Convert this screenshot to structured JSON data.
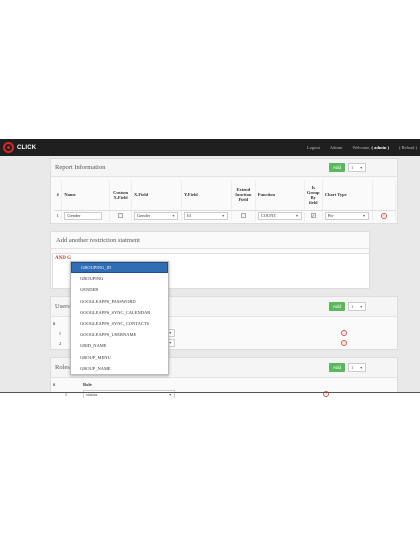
{
  "navbar": {
    "logo": "CLICK",
    "logout": "Logout",
    "admin": "Admin",
    "welcome_prefix": "Welcome,",
    "welcome_user": "( admin )",
    "reload": "( Reload )"
  },
  "report": {
    "title": "Report Information",
    "add_label": "Add",
    "count": "1",
    "headers": [
      "#",
      "Name",
      "Custom X.Field",
      "X.Field",
      "Y.Field",
      "Extend function Field",
      "Function",
      "Is Group By field",
      "Chart Type"
    ],
    "row": {
      "index": "1",
      "name": "Gender",
      "x_field": "Gender",
      "y_field": "Id",
      "function": "COUNT",
      "is_group_by": "✓",
      "chart_type": "Pie",
      "delete": "×"
    }
  },
  "restriction": {
    "title": "Add another restriction statment",
    "text": "AND G"
  },
  "dropdown": {
    "items": [
      "GROUPING_ID",
      "GROUPING",
      "GENDER",
      "GOOGLEAPPS_PASSWORD",
      "GOOGLEAPPS_SYNC_CALENDAR",
      "GOOGLEAPPS_SYNC_CONTACTS",
      "GOOGLEAPPS_USERNAME",
      "GRID_NAME",
      "GROUP_MENU",
      "GROUP_NAME"
    ]
  },
  "users": {
    "title": "Users a",
    "add_label": "Add",
    "count": "1",
    "header_index": "#",
    "rows": [
      "1",
      "2"
    ],
    "delete": "×"
  },
  "roles": {
    "title": "Roles a",
    "add_label": "Add",
    "count": "1",
    "header_index": "#",
    "header_role": "Role",
    "row_index": "1",
    "row_role": "visitor",
    "delete": "×"
  }
}
